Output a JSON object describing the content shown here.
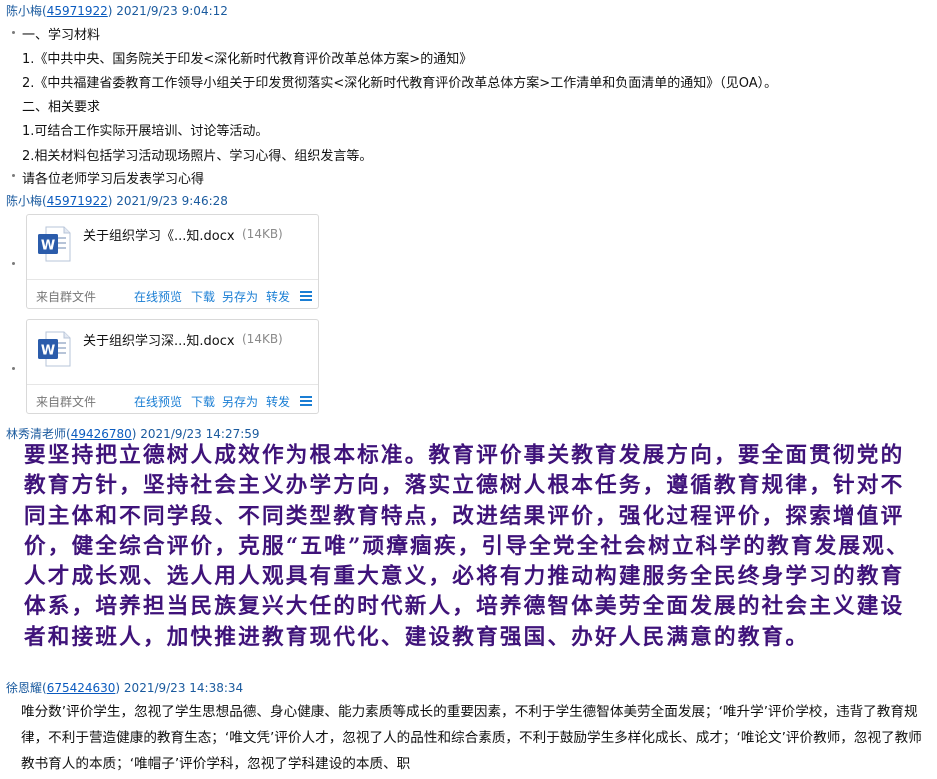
{
  "messages": [
    {
      "sender": "陈小梅",
      "qq": "45971922",
      "time": "2021/9/23 9:04:12",
      "lines": [
        "一、学习材料",
        "1.《中共中央、国务院关于印发<深化新时代教育评价改革总体方案>的通知》",
        "2.《中共福建省委教育工作领导小组关于印发贯彻落实<深化新时代教育评价改革总体方案>工作清单和负面清单的通知》（见OA）。",
        "二、相关要求",
        "1.可结合工作实际开展培训、讨论等活动。",
        "2.相关材料包括学习活动现场照片、学习心得、组织发言等。",
        "请各位老师学习后发表学习心得"
      ]
    },
    {
      "sender": "陈小梅",
      "qq": "45971922",
      "time": "2021/9/23 9:46:28",
      "files": [
        {
          "name": "关于组织学习《...知.docx",
          "size": "(14KB)",
          "source": "来自群文件",
          "icon": "word-doc-icon"
        },
        {
          "name": "关于组织学习深...知.docx",
          "size": "(14KB)",
          "source": "来自群文件",
          "icon": "word-doc-icon"
        }
      ],
      "file_actions": [
        "在线预览",
        "下载",
        "另存为",
        "转发"
      ]
    },
    {
      "sender": "林秀清老师",
      "qq": "49426780",
      "time": "2021/9/23 14:27:59",
      "text": "要坚持把立德树人成效作为根本标准。教育评价事关教育发展方向，要全面贯彻党的教育方针，坚持社会主义办学方向，落实立德树人根本任务，遵循教育规律，针对不同主体和不同学段、不同类型教育特点，改进结果评价，强化过程评价，探索增值评价，健全综合评价，克服“五唯”顽瘴痼疾，引导全党全社会树立科学的教育发展观、人才成长观、选人用人观具有重大意义，必将有力推动构建服务全民终身学习的教育体系，培养担当民族复兴大任的时代新人，培养德智体美劳全面发展的社会主义建设者和接班人，加快推进教育现代化、建设教育强国、办好人民满意的教育。"
    },
    {
      "sender": "徐恩耀",
      "qq": "675424630",
      "time": "2021/9/23 14:38:34",
      "text": "唯分数’评价学生，忽视了学生思想品德、身心健康、能力素质等成长的重要因素，不利于学生德智体美劳全面发展；‘唯升学’评价学校，违背了教育规律，不利于营造健康的教育生态；‘唯文凭’评价人才，忽视了人的品性和综合素质，不利于鼓励学生多样化成长、成才；‘唯论文’评价教师，忽视了教师教书育人的本质；‘唯帽子’评价学科，忽视了学科建设的本质、职"
    }
  ],
  "colors": {
    "header": "#1a5a9e",
    "link": "#0b5bbf",
    "action": "#1a7ed4",
    "purple_text": "#3f137a"
  }
}
